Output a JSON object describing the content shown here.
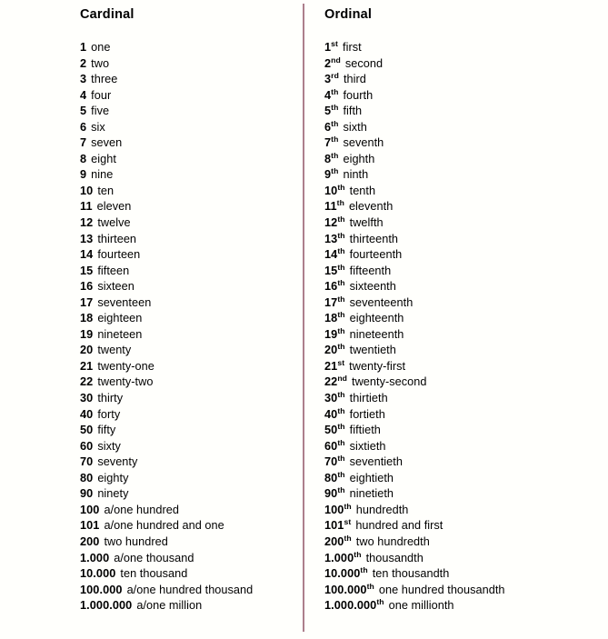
{
  "page": {
    "background_color": "#fffffc",
    "text_color": "#000000",
    "divider_color": "#ad7f8c"
  },
  "cardinal": {
    "header": "Cardinal",
    "rows": [
      {
        "number": "1",
        "word": "one"
      },
      {
        "number": "2",
        "word": "two"
      },
      {
        "number": "3",
        "word": "three"
      },
      {
        "number": "4",
        "word": "four"
      },
      {
        "number": "5",
        "word": "five"
      },
      {
        "number": "6",
        "word": "six"
      },
      {
        "number": "7",
        "word": "seven"
      },
      {
        "number": "8",
        "word": "eight"
      },
      {
        "number": "9",
        "word": "nine"
      },
      {
        "number": "10",
        "word": "ten"
      },
      {
        "number": "11",
        "word": "eleven"
      },
      {
        "number": "12",
        "word": "twelve"
      },
      {
        "number": "13",
        "word": "thirteen"
      },
      {
        "number": "14",
        "word": "fourteen"
      },
      {
        "number": "15",
        "word": "fifteen"
      },
      {
        "number": "16",
        "word": "sixteen"
      },
      {
        "number": "17",
        "word": "seventeen"
      },
      {
        "number": "18",
        "word": "eighteen"
      },
      {
        "number": "19",
        "word": "nineteen"
      },
      {
        "number": "20",
        "word": "twenty"
      },
      {
        "number": "21",
        "word": "twenty-one"
      },
      {
        "number": "22",
        "word": "twenty-two"
      },
      {
        "number": "30",
        "word": "thirty"
      },
      {
        "number": "40",
        "word": "forty"
      },
      {
        "number": "50",
        "word": "fifty"
      },
      {
        "number": "60",
        "word": "sixty"
      },
      {
        "number": "70",
        "word": "seventy"
      },
      {
        "number": "80",
        "word": "eighty"
      },
      {
        "number": "90",
        "word": "ninety"
      },
      {
        "number": "100",
        "word": "a/one hundred"
      },
      {
        "number": "101",
        "word": "a/one hundred and one"
      },
      {
        "number": "200",
        "word": "two hundred"
      },
      {
        "number": "1.000",
        "word": "a/one thousand"
      },
      {
        "number": "10.000",
        "word": "ten thousand"
      },
      {
        "number": "100.000",
        "word": "a/one hundred thousand"
      },
      {
        "number": "1.000.000",
        "word": "a/one million"
      }
    ]
  },
  "ordinal": {
    "header": "Ordinal",
    "rows": [
      {
        "number": "1",
        "suffix": "st",
        "word": "first"
      },
      {
        "number": "2",
        "suffix": "nd",
        "word": "second"
      },
      {
        "number": "3",
        "suffix": "rd",
        "word": "third"
      },
      {
        "number": "4",
        "suffix": "th",
        "word": "fourth"
      },
      {
        "number": "5",
        "suffix": "th",
        "word": "fifth"
      },
      {
        "number": "6",
        "suffix": "th",
        "word": "sixth"
      },
      {
        "number": "7",
        "suffix": "th",
        "word": "seventh"
      },
      {
        "number": "8",
        "suffix": "th",
        "word": "eighth"
      },
      {
        "number": "9",
        "suffix": "th",
        "word": "ninth"
      },
      {
        "number": "10",
        "suffix": "th",
        "word": "tenth"
      },
      {
        "number": "11",
        "suffix": "th",
        "word": "eleventh"
      },
      {
        "number": "12",
        "suffix": "th",
        "word": "twelfth"
      },
      {
        "number": "13",
        "suffix": "th",
        "word": "thirteenth"
      },
      {
        "number": "14",
        "suffix": "th",
        "word": "fourteenth"
      },
      {
        "number": "15",
        "suffix": "th",
        "word": "fifteenth"
      },
      {
        "number": "16",
        "suffix": "th",
        "word": "sixteenth"
      },
      {
        "number": "17",
        "suffix": "th",
        "word": "seventeenth"
      },
      {
        "number": "18",
        "suffix": "th",
        "word": "eighteenth"
      },
      {
        "number": "19",
        "suffix": "th",
        "word": "nineteenth"
      },
      {
        "number": "20",
        "suffix": "th",
        "word": "twentieth"
      },
      {
        "number": "21",
        "suffix": "st",
        "word": "twenty-first"
      },
      {
        "number": "22",
        "suffix": "nd",
        "word": "twenty-second"
      },
      {
        "number": "30",
        "suffix": "th",
        "word": "thirtieth"
      },
      {
        "number": "40",
        "suffix": "th",
        "word": "fortieth"
      },
      {
        "number": "50",
        "suffix": "th",
        "word": "fiftieth"
      },
      {
        "number": "60",
        "suffix": "th",
        "word": "sixtieth"
      },
      {
        "number": "70",
        "suffix": "th",
        "word": "seventieth"
      },
      {
        "number": "80",
        "suffix": "th",
        "word": "eightieth"
      },
      {
        "number": "90",
        "suffix": "th",
        "word": "ninetieth"
      },
      {
        "number": "100",
        "suffix": "th",
        "word": "hundredth"
      },
      {
        "number": "101",
        "suffix": "st",
        "word": "hundred and first"
      },
      {
        "number": "200",
        "suffix": "th",
        "word": "two hundredth"
      },
      {
        "number": "1.000",
        "suffix": "th",
        "word": "thousandth"
      },
      {
        "number": "10.000",
        "suffix": "th",
        "word": "ten thousandth"
      },
      {
        "number": "100.000",
        "suffix": "th",
        "word": "one hundred thousandth"
      },
      {
        "number": "1.000.000",
        "suffix": "th",
        "word": "one millionth"
      }
    ]
  }
}
